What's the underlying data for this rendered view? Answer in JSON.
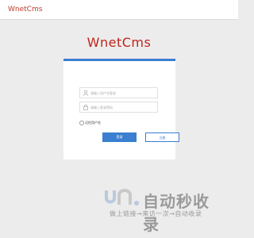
{
  "header": {
    "logo_text": "WnetCms"
  },
  "login": {
    "brand_title": "WnetCms",
    "accent_color": "#3a7fd0",
    "username": {
      "placeholder": "请输入用户名登录",
      "icon": "user-icon"
    },
    "password": {
      "placeholder": "请输入登录密码",
      "icon": "lock-icon"
    },
    "remember_label": "记住用户名",
    "login_button": "登录",
    "register_button": "注册"
  },
  "watermark": {
    "main_text": "自动秒收录",
    "sub_text": "做上链接→来访一次→自动收录"
  }
}
